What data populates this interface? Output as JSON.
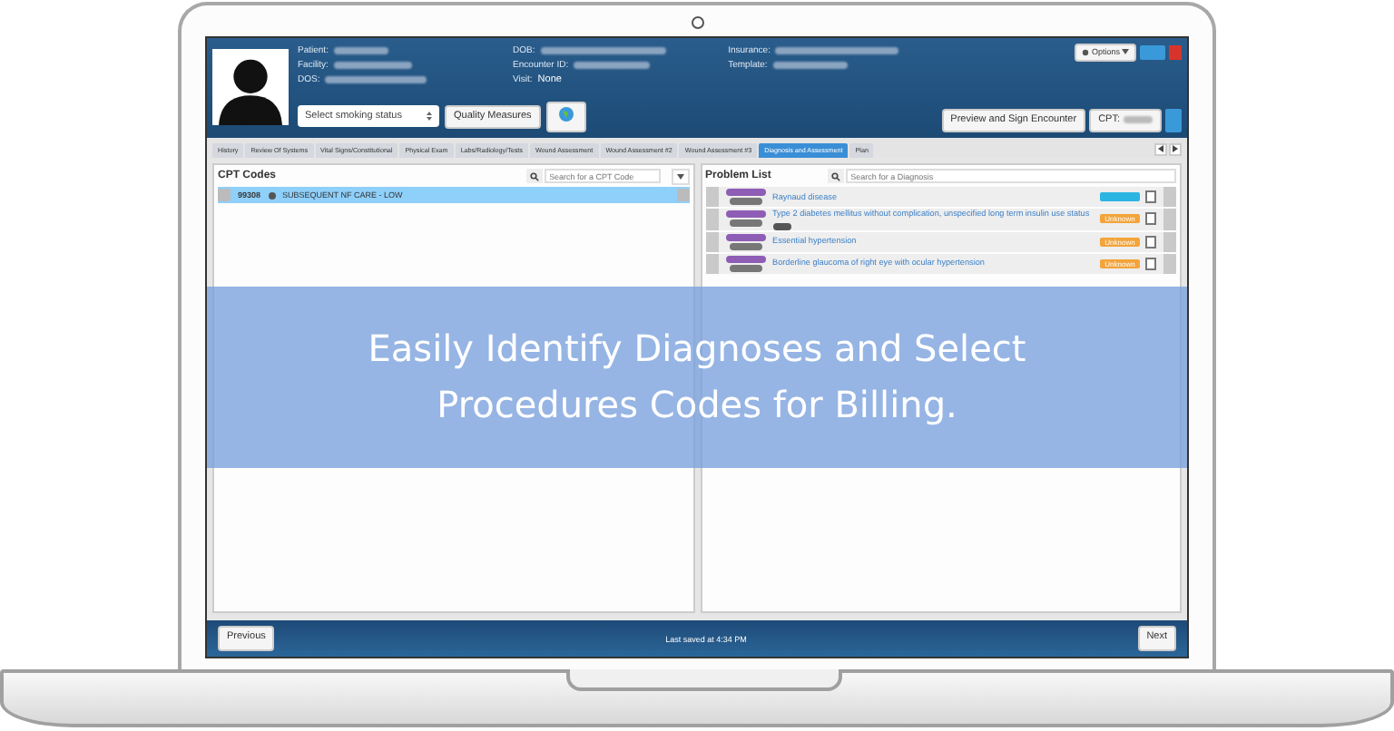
{
  "header": {
    "fields": [
      {
        "label": "Patient:"
      },
      {
        "label": "Facility:"
      },
      {
        "label": "DOS:"
      },
      {
        "label": "DOB:"
      },
      {
        "label": "Encounter ID:"
      },
      {
        "label": "Visit:",
        "value": "None"
      },
      {
        "label": "Insurance:"
      },
      {
        "label": "Template:"
      }
    ],
    "smoking_select": {
      "value": "Select smoking status"
    },
    "quality_button": "Quality Measures",
    "options_button": "Options",
    "preview_button": "Preview and Sign Encounter",
    "cpt_button": "CPT:"
  },
  "tabs": [
    {
      "label": "History",
      "selected": false
    },
    {
      "label": "Review Of Systems",
      "selected": false
    },
    {
      "label": "Vital Signs/Constitutional",
      "selected": false
    },
    {
      "label": "Physical Exam",
      "selected": false
    },
    {
      "label": "Labs/Radiology/Tests",
      "selected": false
    },
    {
      "label": "Wound Assessment",
      "selected": false
    },
    {
      "label": "Wound Assessment #2",
      "selected": false
    },
    {
      "label": "Wound Assessment #3",
      "selected": false
    },
    {
      "label": "Diagnosis and Assessment",
      "selected": true
    },
    {
      "label": "Plan",
      "selected": false
    }
  ],
  "cpt_panel": {
    "title": "CPT Codes",
    "placeholder": "Search for a CPT Code",
    "rows": [
      {
        "code": "99308",
        "description": "SUBSEQUENT NF CARE - LOW",
        "selected": true
      }
    ]
  },
  "problem_panel": {
    "title": "Problem List",
    "placeholder": "Search for a Diagnosis",
    "rows": [
      {
        "name": "Raynaud disease",
        "status": "",
        "color": "#2bb5e3",
        "tagged": false
      },
      {
        "name": "Type 2 diabetes mellitus without complication, unspecified long term insulin use status",
        "status": "Unknown",
        "color": "#f3a43a",
        "tagged": true
      },
      {
        "name": "Essential hypertension",
        "status": "Unknown",
        "color": "#f3a43a",
        "tagged": false
      },
      {
        "name": "Borderline glaucoma of right eye with ocular hypertension",
        "status": "Unknown",
        "color": "#f3a43a",
        "tagged": false
      }
    ]
  },
  "footer": {
    "previous": "Previous",
    "status": "Last saved at 4:34 PM",
    "next": "Next"
  },
  "banner": {
    "lines": [
      "Easily Identify Diagnoses and Select",
      "Procedures Codes for Billing."
    ]
  }
}
